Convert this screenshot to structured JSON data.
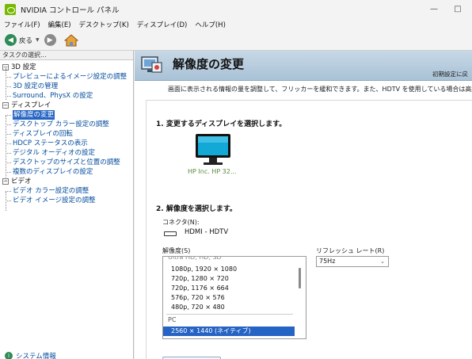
{
  "window": {
    "title": "NVIDIA コントロール パネル",
    "minimize_glyph": "—",
    "maximize_glyph": "□"
  },
  "menu": [
    "ファイル(F)",
    "編集(E)",
    "デスクトップ(K)",
    "ディスプレイ(D)",
    "ヘルプ(H)"
  ],
  "toolbar": {
    "back_label": "戻る",
    "back_icon": "back-arrow",
    "forward_icon": "forward-arrow",
    "home_icon": "home"
  },
  "sidebar": {
    "header": "タスクの選択...",
    "categories": [
      {
        "label": "3D 設定",
        "toggle": "−",
        "items": [
          "プレビューによるイメージ設定の調整",
          "3D 設定の管理",
          "Surround、PhysX の設定"
        ]
      },
      {
        "label": "ディスプレイ",
        "toggle": "−",
        "items": [
          "解像度の変更",
          "デスクトップ カラー設定の調整",
          "ディスプレイの回転",
          "HDCP ステータスの表示",
          "デジタル オーディオの設定",
          "デスクトップのサイズと位置の調整",
          "複数のディスプレイの設定"
        ],
        "selected": "解像度の変更"
      },
      {
        "label": "ビデオ",
        "toggle": "−",
        "items": [
          "ビデオ カラー設定の調整",
          "ビデオ イメージ設定の調整"
        ]
      }
    ],
    "system_info": "システム情報"
  },
  "page": {
    "title": "解像度の変更",
    "restore_defaults": "初期設定に戻",
    "description": "画面に表示される情報の量を調整して、フリッカーを緩和できます。また、HDTV を使用している場合は高解",
    "step1": "1. 変更するディスプレイを選択します。",
    "display_name": "HP Inc. HP 32...",
    "step2": "2. 解像度を選択します。",
    "connector_label": "コネクタ(N):",
    "connector_value": "HDMI - HDTV",
    "resolution_label": "解像度(S)",
    "refresh_label": "リフレッシュ レート(R)",
    "refresh_value": "75Hz",
    "resolution_list": {
      "partial_group": "Ultra HD, HD, SD",
      "hd_items": [
        "1080p, 1920 × 1080",
        "720p, 1280 × 720",
        "720p, 1176 × 664",
        "576p, 720 × 576",
        "480p, 720 × 480"
      ],
      "pc_group": "PC",
      "pc_items": [
        "2560 × 1440 (ネイティブ)"
      ],
      "selected": "2560 × 1440 (ネイティブ)"
    }
  },
  "colors": {
    "accent_selection": "#2563c4",
    "nvidia_green": "#76b900",
    "header_band": "#b7cddf",
    "link": "#004a9c"
  }
}
